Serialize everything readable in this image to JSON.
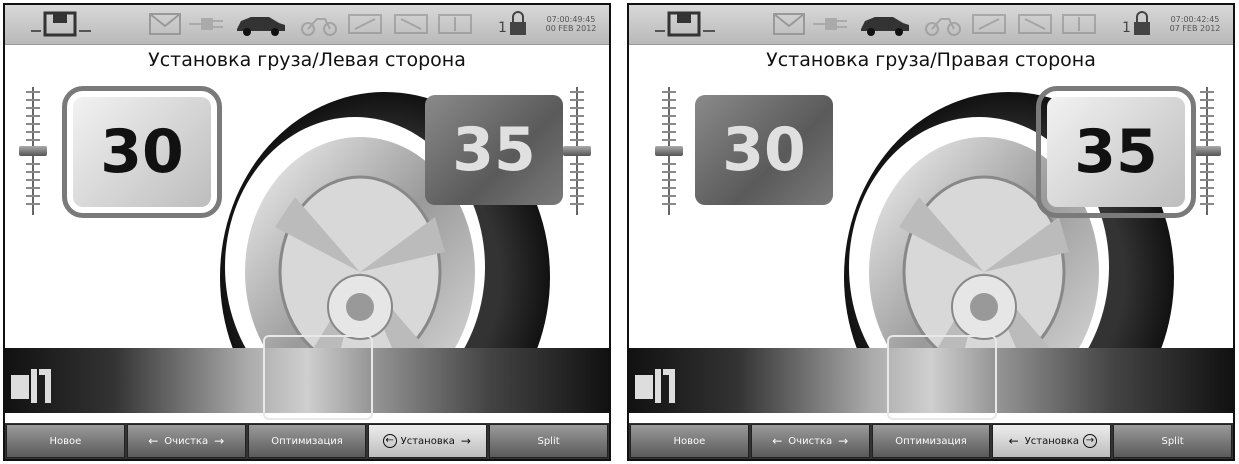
{
  "screens": [
    {
      "title": "Установка груза/Левая сторона",
      "left_value": "30",
      "right_value": "35",
      "active_side": "left",
      "clock": [
        "07:00:49:45",
        "00 FEB 2012"
      ],
      "nav": [
        {
          "label": "Новое",
          "selected": false
        },
        {
          "label": "Очистка",
          "selected": false
        },
        {
          "label": "Оптимизация",
          "selected": false
        },
        {
          "label": "Установка",
          "selected": true
        },
        {
          "label": "Split",
          "selected": false
        }
      ]
    },
    {
      "title": "Установка груза/Правая сторона",
      "left_value": "30",
      "right_value": "35",
      "active_side": "right",
      "clock": [
        "07:00:42:45",
        "07 FEB 2012"
      ],
      "nav": [
        {
          "label": "Новое",
          "selected": false
        },
        {
          "label": "Очистка",
          "selected": false
        },
        {
          "label": "Оптимизация",
          "selected": false
        },
        {
          "label": "Установка",
          "selected": true
        },
        {
          "label": "Split",
          "selected": false
        }
      ]
    }
  ],
  "icons": {
    "machine": "wheel-balancer-icon",
    "mail": "mail-icon",
    "plug": "plug-icon",
    "car": "car-icon",
    "lock": "padlock-icon",
    "strip": "weight-applicator-icon"
  },
  "colors": {
    "active_box": "#d9d9d9",
    "inactive_box": "#6a6a6a",
    "nav_button": "#7a7a7a",
    "nav_selected": "#d8d8d8"
  }
}
